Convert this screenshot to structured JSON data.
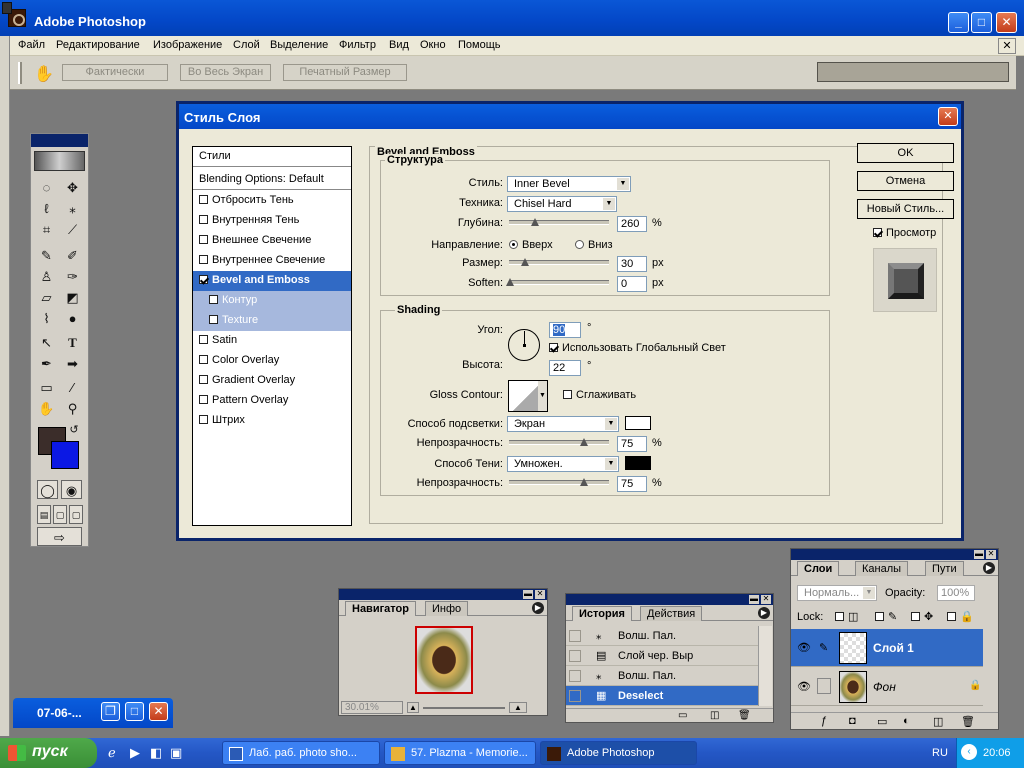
{
  "app": {
    "title": "Adobe Photoshop"
  },
  "menu": [
    "Файл",
    "Редактирование",
    "Изображение",
    "Слой",
    "Выделение",
    "Фильтр",
    "Вид",
    "Окно",
    "Помощь"
  ],
  "options_bar": {
    "buttons": [
      "Фактически",
      "Во Весь Экран",
      "Печатный Размер"
    ]
  },
  "dialog": {
    "title": "Стиль Слоя",
    "styles_header": "Стили",
    "blending": "Blending Options: Default",
    "style_items": [
      {
        "label": "Отбросить Тень",
        "checked": false
      },
      {
        "label": "Внутренняя Тень",
        "checked": false
      },
      {
        "label": "Внешнее Свечение",
        "checked": false
      },
      {
        "label": "Внутреннее Свечение",
        "checked": false
      },
      {
        "label": "Bevel and Emboss",
        "checked": true
      },
      {
        "label": "Контур",
        "checked": false
      },
      {
        "label": "Texture",
        "checked": false
      },
      {
        "label": "Satin",
        "checked": false
      },
      {
        "label": "Color Overlay",
        "checked": false
      },
      {
        "label": "Gradient Overlay",
        "checked": false
      },
      {
        "label": "Pattern Overlay",
        "checked": false
      },
      {
        "label": "Штрих",
        "checked": false
      }
    ],
    "panel_title": "Bevel and Emboss",
    "structure": {
      "title": "Структура",
      "style_label": "Стиль:",
      "style_value": "Inner Bevel",
      "technique_label": "Техника:",
      "technique_value": "Chisel Hard",
      "depth_label": "Глубина:",
      "depth_value": "260",
      "depth_unit": "%",
      "direction_label": "Направление:",
      "dir_up": "Вверх",
      "dir_down": "Вниз",
      "size_label": "Размер:",
      "size_value": "30",
      "size_unit": "px",
      "soften_label": "Soften:",
      "soften_value": "0",
      "soften_unit": "px"
    },
    "shading": {
      "title": "Shading",
      "angle_label": "Угол:",
      "angle_value": "90",
      "angle_unit": "°",
      "global_light": "Использовать Глобальный Свет",
      "altitude_label": "Высота:",
      "altitude_value": "22",
      "altitude_unit": "°",
      "gloss_label": "Gloss Contour:",
      "antialias": "Сглаживать",
      "highlight_label": "Способ подсветки:",
      "highlight_mode": "Экран",
      "highlight_opacity_label": "Непрозрачность:",
      "highlight_opacity": "75",
      "pct": "%",
      "shadow_label": "Способ Тени:",
      "shadow_mode": "Умножен.",
      "shadow_opacity_label": "Непрозрачность:",
      "shadow_opacity": "75"
    },
    "buttons": {
      "ok": "OK",
      "cancel": "Отмена",
      "new_style": "Новый Стиль...",
      "preview": "Просмотр"
    }
  },
  "navigator": {
    "tabs": [
      "Навигатор",
      "Инфо"
    ],
    "zoom": "30.01%"
  },
  "history": {
    "tabs": [
      "История",
      "Действия"
    ],
    "items": [
      {
        "label": "Волш. Пал.",
        "selected": false
      },
      {
        "label": "Слой чер. Выр",
        "selected": false
      },
      {
        "label": "Волш. Пал.",
        "selected": false
      },
      {
        "label": "Deselect",
        "selected": true
      }
    ]
  },
  "layers": {
    "tabs": [
      "Слои",
      "Каналы",
      "Пути"
    ],
    "blend_mode": "Нормаль...",
    "opacity_label": "Opacity:",
    "opacity_value": "100%",
    "lock_label": "Lock:",
    "items": [
      {
        "name": "Слой 1",
        "selected": true
      },
      {
        "name": "Фон",
        "selected": false
      }
    ]
  },
  "minimized_doc": {
    "title": "07-06-..."
  },
  "taskbar": {
    "start": "пуск",
    "items": [
      {
        "label": "Лаб. раб. photo sho..."
      },
      {
        "label": "57. Plazma - Memorie..."
      },
      {
        "label": "Adobe Photoshop"
      }
    ],
    "lang": "RU",
    "time": "20:06"
  }
}
